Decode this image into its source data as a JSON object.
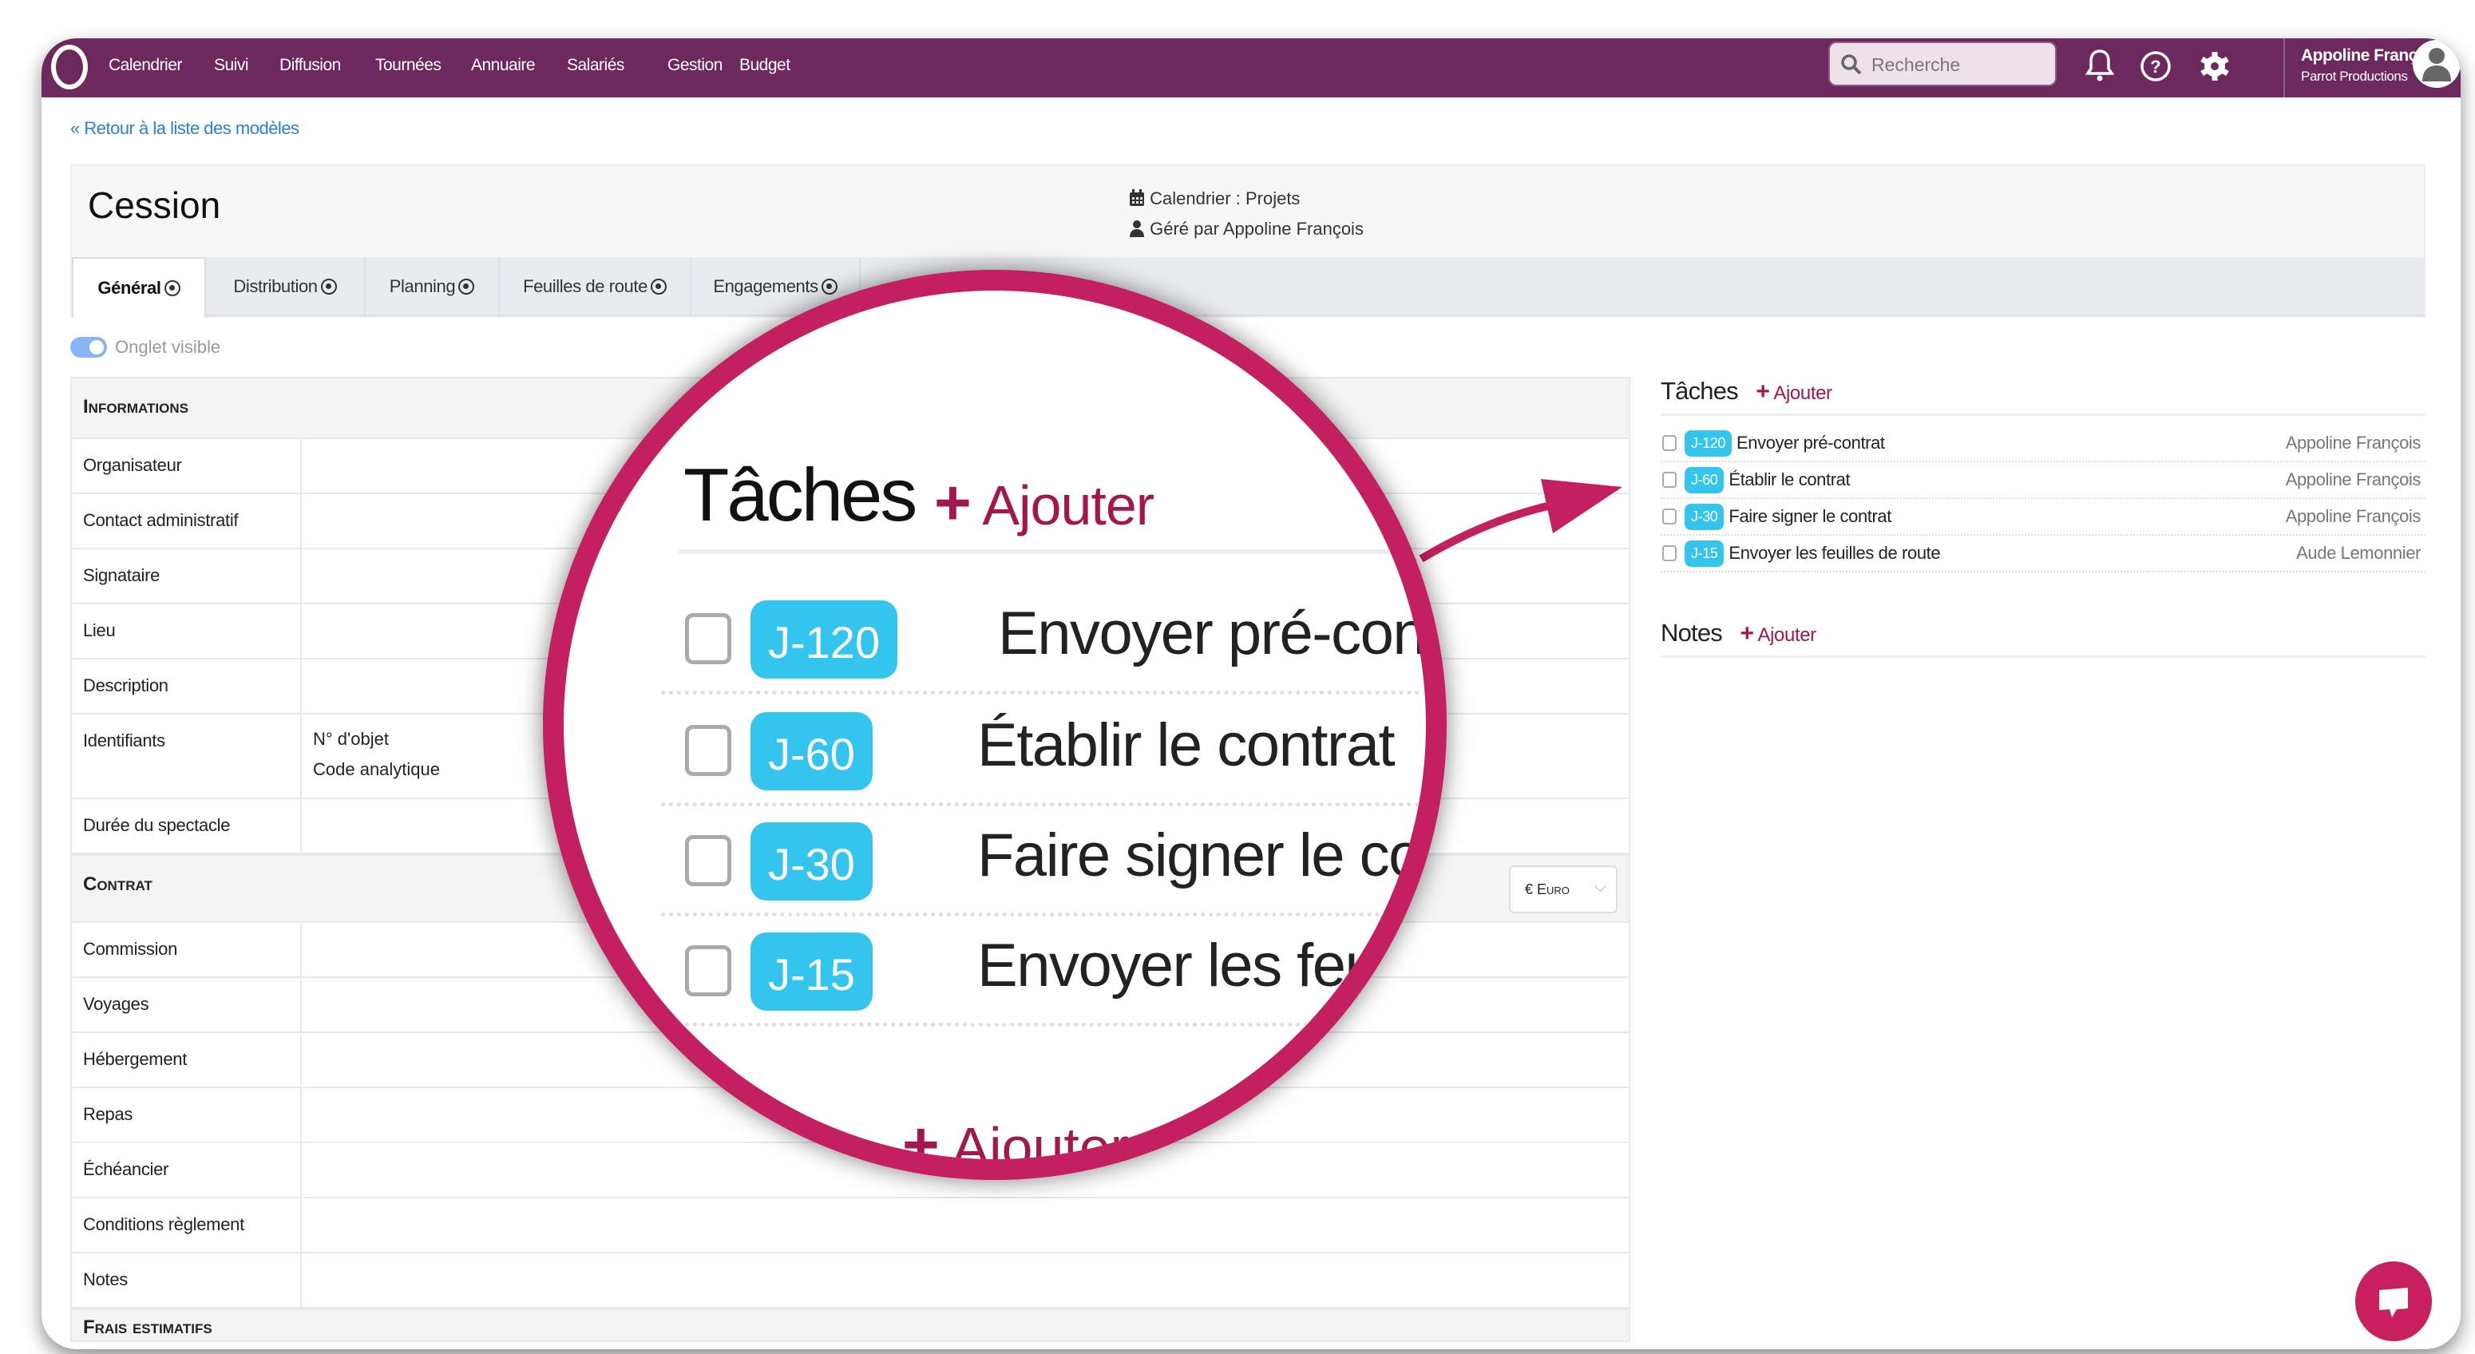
{
  "nav": {
    "items": [
      "Calendrier",
      "Suivi",
      "Diffusion",
      "Tournées",
      "Annuaire",
      "Salariés",
      "Gestion",
      "Budget"
    ],
    "search_placeholder": "Recherche",
    "user_name": "Appoline François",
    "user_org": "Parrot Productions"
  },
  "back_link": "« Retour à la liste des modèles",
  "header": {
    "title": "Cession",
    "calendar": "Calendrier : Projets",
    "manager": "Géré par Appoline François"
  },
  "tabs": [
    "Général",
    "Distribution",
    "Planning",
    "Feuilles de route",
    "Engagements"
  ],
  "active_tab": "Général",
  "toggle": {
    "label": "Onglet visible",
    "on": true
  },
  "sections": [
    {
      "title": "Informations",
      "rows": [
        {
          "label": "Organisateur",
          "value": ""
        },
        {
          "label": "Contact administratif",
          "value": ""
        },
        {
          "label": "Signataire",
          "value": ""
        },
        {
          "label": "Lieu",
          "value": ""
        },
        {
          "label": "Description",
          "value": ""
        },
        {
          "label": "Identifiants",
          "value": "N° d'objet\nCode analytique"
        },
        {
          "label": "Durée du spectacle",
          "value": ""
        }
      ]
    },
    {
      "title": "Contrat",
      "currency": "€ Euro",
      "rows": [
        {
          "label": "Commission",
          "value": ""
        },
        {
          "label": "Voyages",
          "value": ""
        },
        {
          "label": "Hébergement",
          "value": ""
        },
        {
          "label": "Repas",
          "value": ""
        },
        {
          "label": "Échéancier",
          "value": ""
        },
        {
          "label": "Conditions règlement",
          "value": ""
        },
        {
          "label": "Notes",
          "value": ""
        }
      ]
    },
    {
      "title": "Frais estimatifs",
      "rows": []
    }
  ],
  "tasks": {
    "title": "Tâches",
    "add_label": "Ajouter",
    "items": [
      {
        "badge": "J-120",
        "label": "Envoyer pré-contrat",
        "assignee": "Appoline François",
        "done": false
      },
      {
        "badge": "J-60",
        "label": "Établir le contrat",
        "assignee": "Appoline François",
        "done": false
      },
      {
        "badge": "J-30",
        "label": "Faire signer le contrat",
        "assignee": "Appoline François",
        "done": false
      },
      {
        "badge": "J-15",
        "label": "Envoyer les feuilles de route",
        "assignee": "Aude Lemonnier",
        "done": false
      }
    ]
  },
  "notes": {
    "title": "Notes",
    "add_label": "Ajouter"
  },
  "colors": {
    "nav": "#6d285e",
    "accent": "#c41f5f",
    "badge": "#34c5ee",
    "link": "#2a7de1"
  }
}
